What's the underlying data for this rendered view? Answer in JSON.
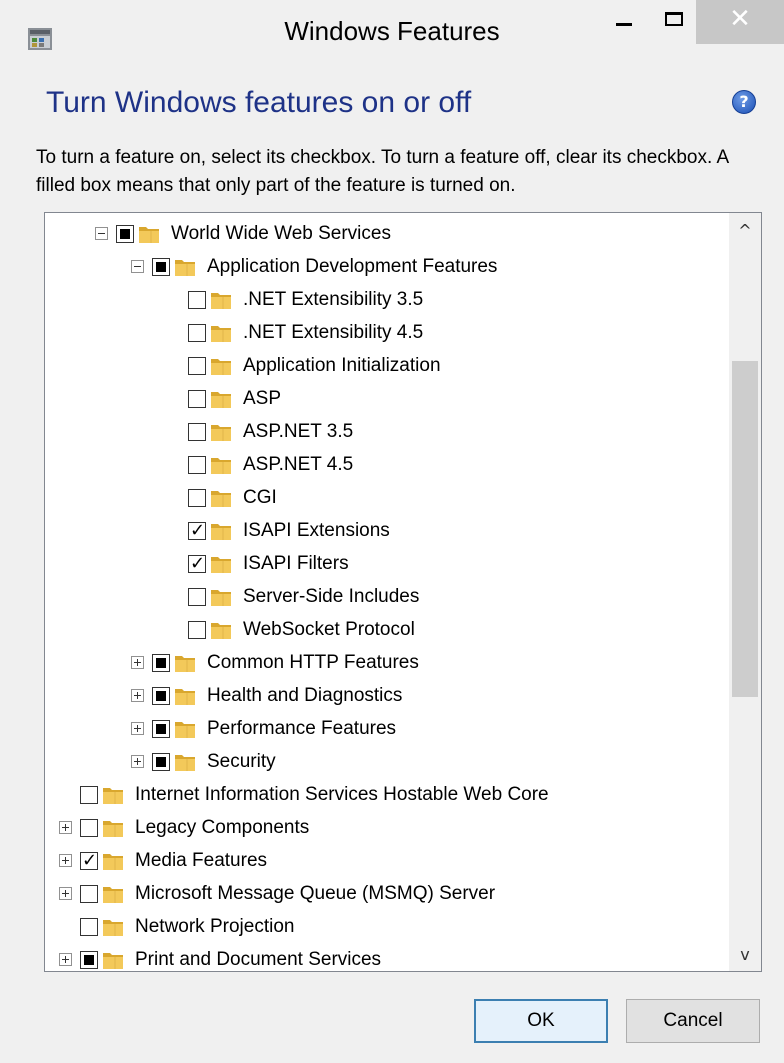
{
  "window": {
    "title": "Windows Features"
  },
  "dialog": {
    "heading": "Turn Windows features on or off",
    "description": "To turn a feature on, select its checkbox. To turn a feature off, clear its checkbox. A filled box means that only part of the feature is turned on."
  },
  "tree": {
    "items": [
      {
        "label": "World Wide Web Services",
        "state": "partial",
        "expander": "minus",
        "depth": 1
      },
      {
        "label": "Application Development Features",
        "state": "partial",
        "expander": "minus",
        "depth": 2
      },
      {
        "label": ".NET Extensibility 3.5",
        "state": "unchecked",
        "expander": "none",
        "depth": 3
      },
      {
        "label": ".NET Extensibility 4.5",
        "state": "unchecked",
        "expander": "none",
        "depth": 3
      },
      {
        "label": "Application Initialization",
        "state": "unchecked",
        "expander": "none",
        "depth": 3
      },
      {
        "label": "ASP",
        "state": "unchecked",
        "expander": "none",
        "depth": 3
      },
      {
        "label": "ASP.NET 3.5",
        "state": "unchecked",
        "expander": "none",
        "depth": 3
      },
      {
        "label": "ASP.NET 4.5",
        "state": "unchecked",
        "expander": "none",
        "depth": 3
      },
      {
        "label": "CGI",
        "state": "unchecked",
        "expander": "none",
        "depth": 3
      },
      {
        "label": "ISAPI Extensions",
        "state": "checked",
        "expander": "none",
        "depth": 3
      },
      {
        "label": "ISAPI Filters",
        "state": "checked",
        "expander": "none",
        "depth": 3
      },
      {
        "label": "Server-Side Includes",
        "state": "unchecked",
        "expander": "none",
        "depth": 3
      },
      {
        "label": "WebSocket Protocol",
        "state": "unchecked",
        "expander": "none",
        "depth": 3
      },
      {
        "label": "Common HTTP Features",
        "state": "partial",
        "expander": "plus",
        "depth": 2
      },
      {
        "label": "Health and Diagnostics",
        "state": "partial",
        "expander": "plus",
        "depth": 2
      },
      {
        "label": "Performance Features",
        "state": "partial",
        "expander": "plus",
        "depth": 2
      },
      {
        "label": "Security",
        "state": "partial",
        "expander": "plus",
        "depth": 2
      },
      {
        "label": "Internet Information Services Hostable Web Core",
        "state": "unchecked",
        "expander": "none",
        "depth": 0
      },
      {
        "label": "Legacy Components",
        "state": "unchecked",
        "expander": "plus",
        "depth": 0
      },
      {
        "label": "Media Features",
        "state": "checked",
        "expander": "plus",
        "depth": 0
      },
      {
        "label": "Microsoft Message Queue (MSMQ) Server",
        "state": "unchecked",
        "expander": "plus",
        "depth": 0
      },
      {
        "label": "Network Projection",
        "state": "unchecked",
        "expander": "none",
        "depth": 0
      },
      {
        "label": "Print and Document Services",
        "state": "partial",
        "expander": "plus",
        "depth": 0
      }
    ]
  },
  "buttons": {
    "ok": "OK",
    "cancel": "Cancel"
  },
  "icons": {
    "window": "windows-features-app-icon",
    "help": "help-icon",
    "folder": "folder-icon",
    "minimize": "minimize-icon",
    "maximize": "maximize-icon",
    "close": "close-icon"
  },
  "colors": {
    "heading": "#1e3287",
    "close_button": "#c7c7c7",
    "dialog_bg": "#f0f0f0",
    "ok_border": "#3c7fb1"
  }
}
